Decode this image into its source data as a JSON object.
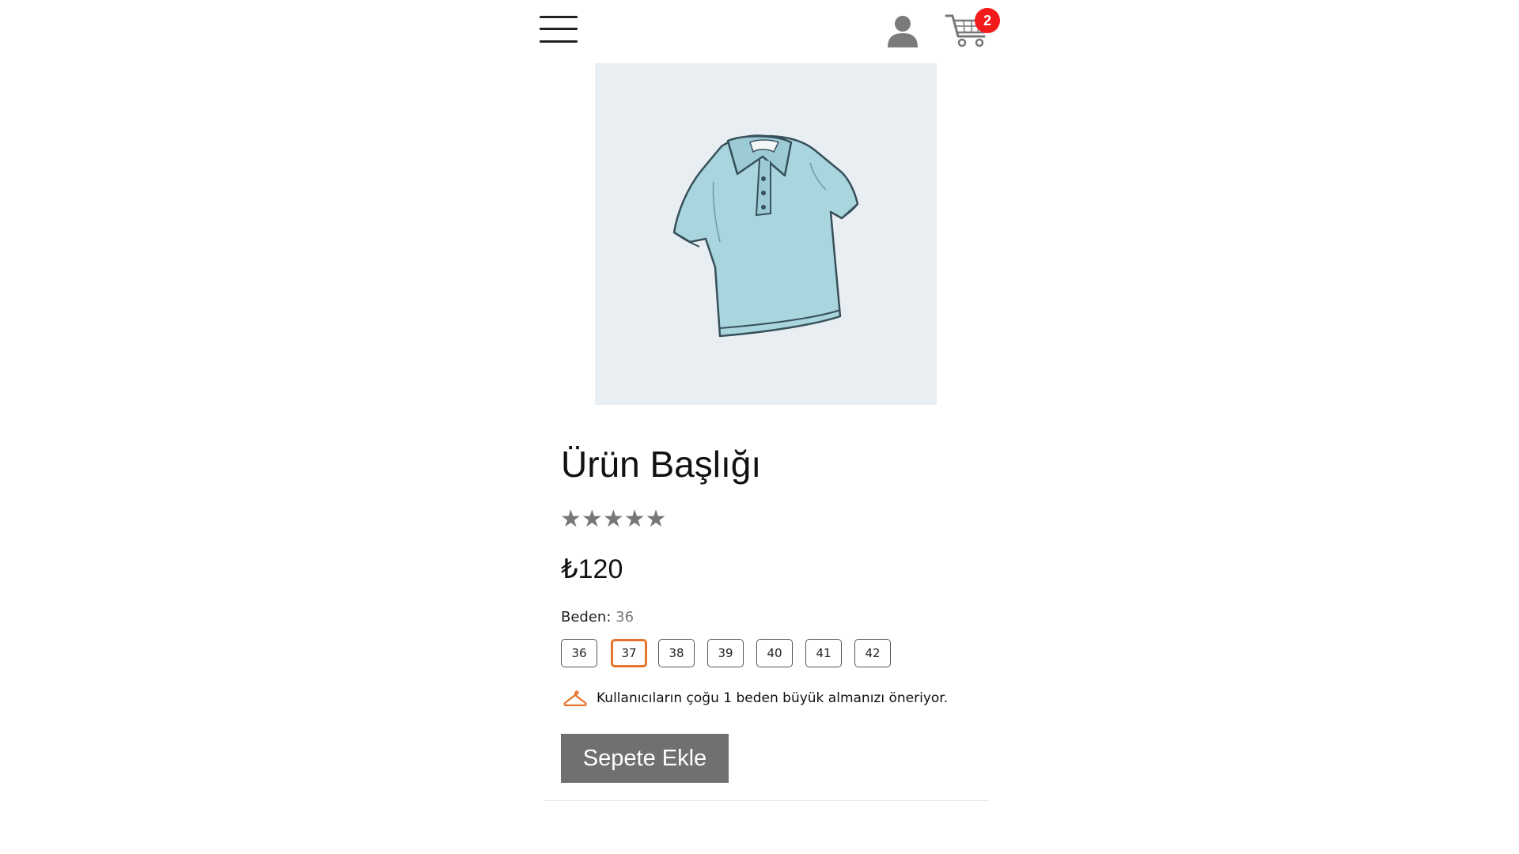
{
  "header": {
    "cart_count": "2",
    "icons": {
      "menu": "hamburger-menu-icon",
      "user": "user-icon",
      "cart": "cart-icon"
    }
  },
  "product": {
    "title": "Ürün Başlığı",
    "rating_stars": [
      "★",
      "★",
      "★",
      "★",
      "★"
    ],
    "price": "₺120",
    "image": "polo-shirt-illustration"
  },
  "size": {
    "label": "Beden:",
    "selected_value": "36",
    "options": [
      "36",
      "37",
      "38",
      "39",
      "40",
      "41",
      "42"
    ],
    "highlighted": "37"
  },
  "advice": {
    "icon": "hanger-icon",
    "text": "Kullanıcıların çoğu 1 beden büyük almanızı öneriyor."
  },
  "actions": {
    "add_to_cart": "Sepete Ekle"
  },
  "colors": {
    "accent": "#e8732a",
    "badge": "#f21a1a",
    "button": "#707070",
    "image_bg": "#e9eef2"
  }
}
